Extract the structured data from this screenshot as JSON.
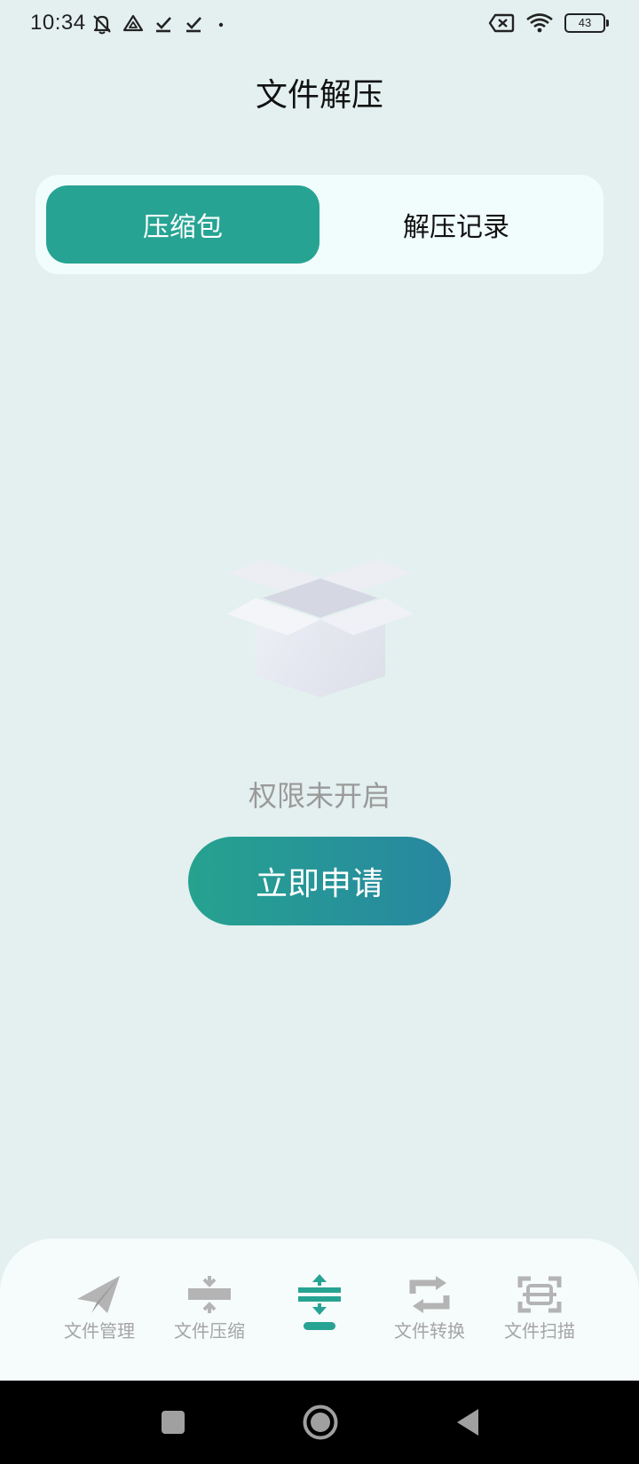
{
  "status_bar": {
    "time": "10:34",
    "battery": "43"
  },
  "header": {
    "title": "文件解压"
  },
  "tabs": [
    {
      "label": "压缩包",
      "active": true
    },
    {
      "label": "解压记录",
      "active": false
    }
  ],
  "empty_state": {
    "icon": "empty-box-icon",
    "message": "权限未开启",
    "button_label": "立即申请"
  },
  "bottom_nav": {
    "items": [
      {
        "label": "文件管理",
        "icon": "paper-plane-icon"
      },
      {
        "label": "文件压缩",
        "icon": "compress-icon"
      },
      {
        "label": "",
        "icon": "extract-icon",
        "active": true
      },
      {
        "label": "文件转换",
        "icon": "convert-icon"
      },
      {
        "label": "文件扫描",
        "icon": "scan-icon"
      }
    ]
  },
  "colors": {
    "accent": "#27a393",
    "background": "#e3f0ef",
    "button_gradient_start": "#26a28f",
    "button_gradient_end": "#2787a0",
    "inactive_icon": "#b4b4b4"
  }
}
